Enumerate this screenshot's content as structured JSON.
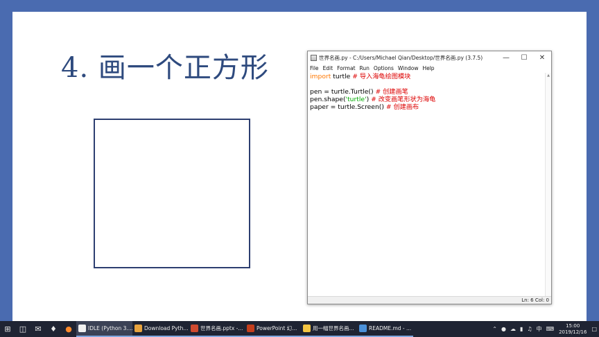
{
  "slide": {
    "title": "4. 画一个正方形"
  },
  "idle": {
    "title": "世界名画.py - C:/Users/Michael Qian/Desktop/世界名画.py (3.7.5)",
    "menus": [
      "File",
      "Edit",
      "Format",
      "Run",
      "Options",
      "Window",
      "Help"
    ],
    "code": {
      "l1_kw": "import",
      "l1_rest": " turtle ",
      "l1_cm": "# 导入海龟绘图模块",
      "l3_code": "pen = turtle.Turtle() ",
      "l3_cm": "# 创建画笔",
      "l4_a": "pen.shape(",
      "l4_str": "'turtle'",
      "l4_b": ") ",
      "l4_cm": "# 改变画笔形状为海龟",
      "l5_code": "paper = turtle.Screen() ",
      "l5_cm": "# 创建画布"
    },
    "status": "Ln: 6   Col: 0"
  },
  "taskbar": {
    "apps": [
      {
        "label": "IDLE (Python 3....",
        "color": "#f0f0f0",
        "active": true
      },
      {
        "label": "Download Pyth...",
        "color": "#e8a33d",
        "active": false
      },
      {
        "label": "世界名画.pptx -...",
        "color": "#d04a2f",
        "active": false
      },
      {
        "label": "PowerPoint 幻...",
        "color": "#c43e1c",
        "active": false
      },
      {
        "label": "用一幅世界名画...",
        "color": "#f4c542",
        "active": false
      },
      {
        "label": "README.md - ...",
        "color": "#4a90d9",
        "active": false
      }
    ],
    "tray_lang": "中",
    "time": "15:00",
    "date": "2019/12/16"
  },
  "colors": {
    "background": "#4a6bb0",
    "title_blue": "#2e4a7e",
    "taskbar": "#1f2433",
    "keyword": "#ff7700",
    "comment": "#dd0000",
    "string": "#00aa00"
  }
}
